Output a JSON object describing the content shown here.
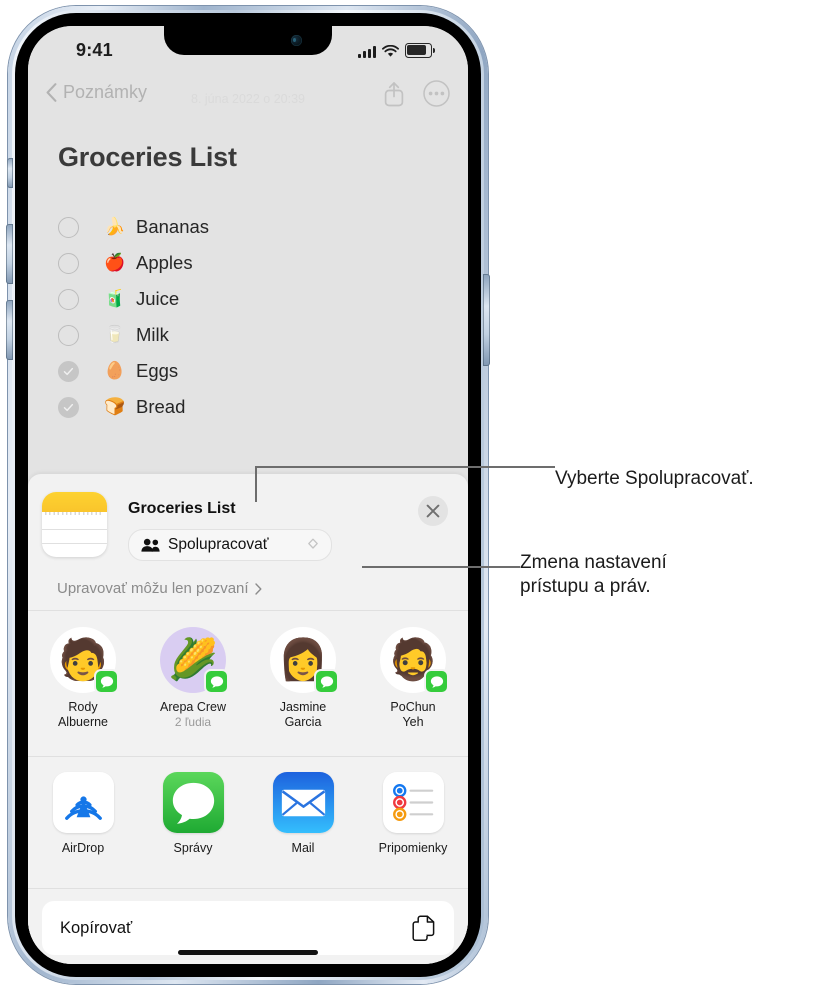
{
  "status_bar": {
    "time": "9:41",
    "icons": [
      "cellular-signal-icon",
      "wifi-icon",
      "battery-icon"
    ]
  },
  "note_screen": {
    "back_label": "Poznámky",
    "date": "8. júna 2022 o 20:39",
    "title": "Groceries List",
    "actions": [
      "share-icon",
      "more-icon"
    ],
    "checklist": [
      {
        "emoji": "🍌",
        "label": "Bananas",
        "checked": false
      },
      {
        "emoji": "🍎",
        "label": "Apples",
        "checked": false
      },
      {
        "emoji": "🧃",
        "label": "Juice",
        "checked": false
      },
      {
        "emoji": "🥛",
        "label": "Milk",
        "checked": false
      },
      {
        "emoji": "🥚",
        "label": "Eggs",
        "checked": true
      },
      {
        "emoji": "🍞",
        "label": "Bread",
        "checked": true
      }
    ]
  },
  "share_sheet": {
    "doc_title": "Groceries List",
    "doc_icon": "notes-app-icon",
    "collaborate_option": "Spolupracovať",
    "permissions_label": "Upravovať môžu len pozvaní",
    "close_label": "×",
    "contacts": [
      {
        "name_line1": "Rody",
        "name_line2": "Albuerne",
        "sub": "",
        "emoji": "🧑",
        "bg": "#ffffff"
      },
      {
        "name_line1": "Arepa Crew",
        "name_line2": "",
        "sub": "2 ľudia",
        "emoji": "🌽",
        "bg": "#d9cdf2"
      },
      {
        "name_line1": "Jasmine",
        "name_line2": "Garcia",
        "sub": "",
        "emoji": "👩",
        "bg": "#ffffff"
      },
      {
        "name_line1": "PoChun",
        "name_line2": "Yeh",
        "sub": "",
        "emoji": "🧔",
        "bg": "#ffffff"
      }
    ],
    "apps": [
      {
        "name": "AirDrop",
        "icon": "airdrop-icon"
      },
      {
        "name": "Správy",
        "icon": "messages-icon"
      },
      {
        "name": "Mail",
        "icon": "mail-icon"
      },
      {
        "name": "Pripomienky",
        "icon": "reminders-icon"
      }
    ],
    "copy_action": "Kopírovať"
  },
  "callouts": {
    "one": "Vyberte Spolupracovať.",
    "two_line1": "Zmena nastavení",
    "two_line2": "prístupu a práv."
  },
  "colors": {
    "sheet_bg": "#f2f2f2",
    "note_bg": "#e3e3e3",
    "badge_green": "#35cc3c",
    "notes_yellow": "#fdd230",
    "accent_blue": "#007aff"
  }
}
